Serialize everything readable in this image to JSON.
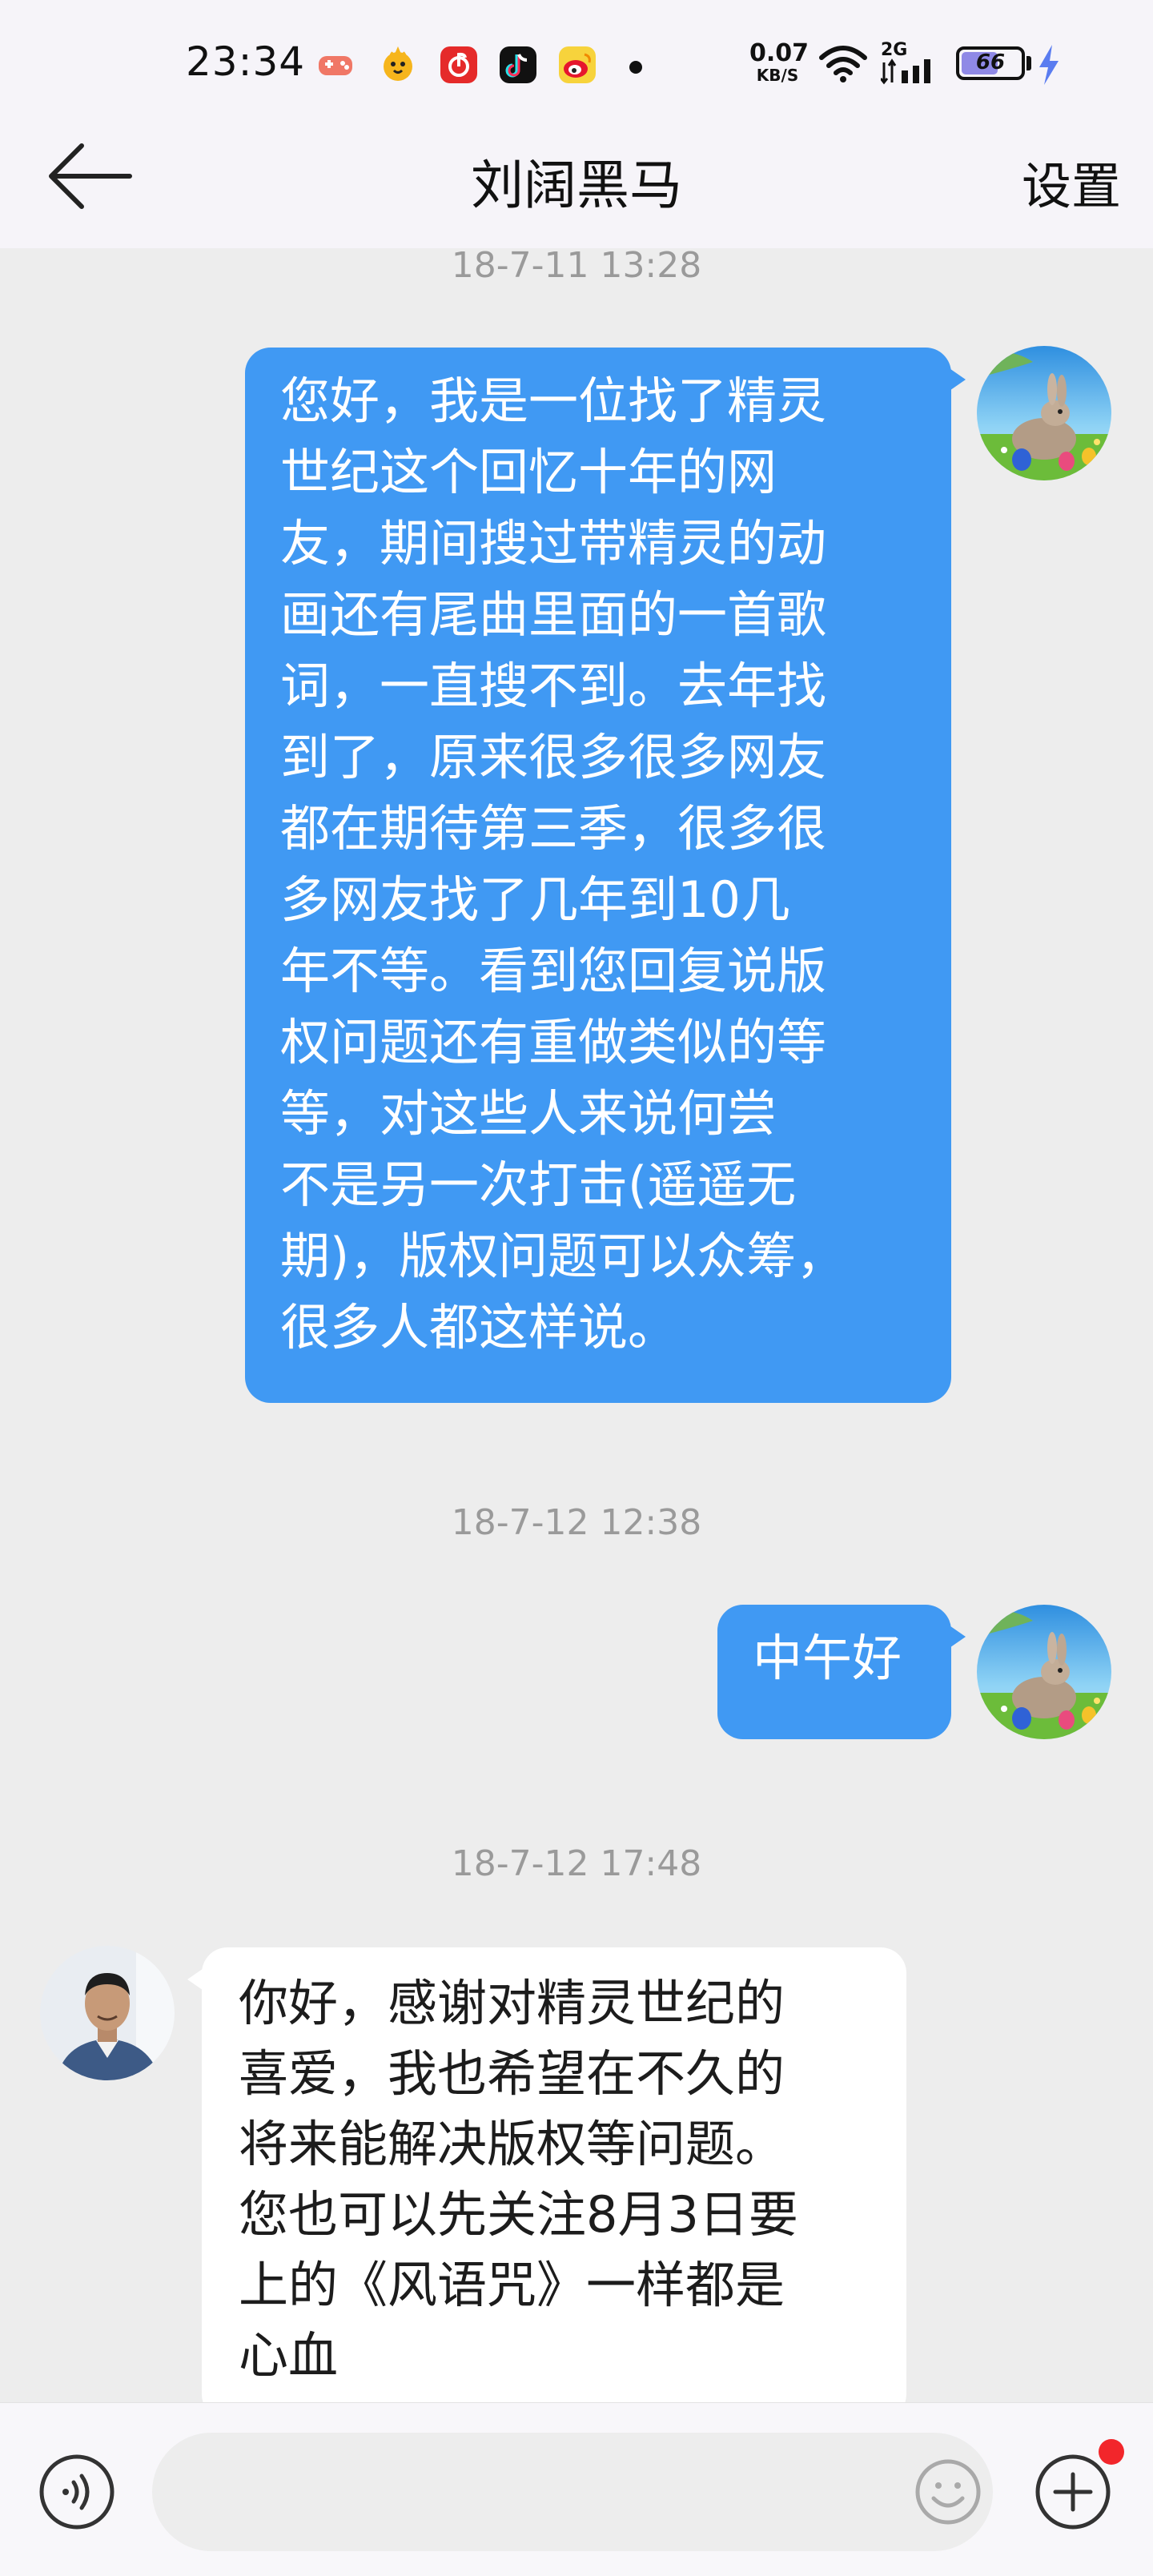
{
  "status_bar": {
    "time": "23:34",
    "net_speed_value": "0.07",
    "net_speed_unit": "KB/S",
    "signal_label": "2G",
    "battery_level": "66",
    "battery_percent": 66,
    "app_icons": [
      "game-controller-icon",
      "chick-app-icon",
      "netease-music-icon",
      "tiktok-icon",
      "weibo-icon"
    ]
  },
  "header": {
    "title": "刘阔黑马",
    "settings_label": "设置"
  },
  "messages": [
    {
      "timestamp": "18-7-11 13:28",
      "direction": "out",
      "text": "您好，我是一位找了精灵\n世纪这个回忆十年的网\n友，期间搜过带精灵的动\n画还有尾曲里面的一首歌\n词，一直搜不到。去年找\n到了，原来很多很多网友\n都在期待第三季，很多很\n多网友找了几年到10几\n年不等。看到您回复说版\n权问题还有重做类似的等\n等，对这些人来说何尝\n不是另一次打击(遥遥无\n期)，版权问题可以众筹，\n很多人都这样说。"
    },
    {
      "timestamp": "18-7-12 12:38",
      "direction": "out",
      "text": "中午好"
    },
    {
      "timestamp": "18-7-12 17:48",
      "direction": "in",
      "text": "你好，感谢对精灵世纪的\n喜爱，我也希望在不久的\n将来能解决版权等问题。\n您也可以先关注8月3日要\n上的《风语咒》一样都是\n心血"
    }
  ],
  "input_bar": {
    "placeholder": ""
  },
  "colors": {
    "outgoing_bubble": "#4099f3",
    "incoming_bubble": "#ffffff",
    "chat_background": "#ededed",
    "header_background": "#f6f4f9",
    "timestamp_text": "#9a9a9a",
    "badge_red": "#f2262b"
  }
}
